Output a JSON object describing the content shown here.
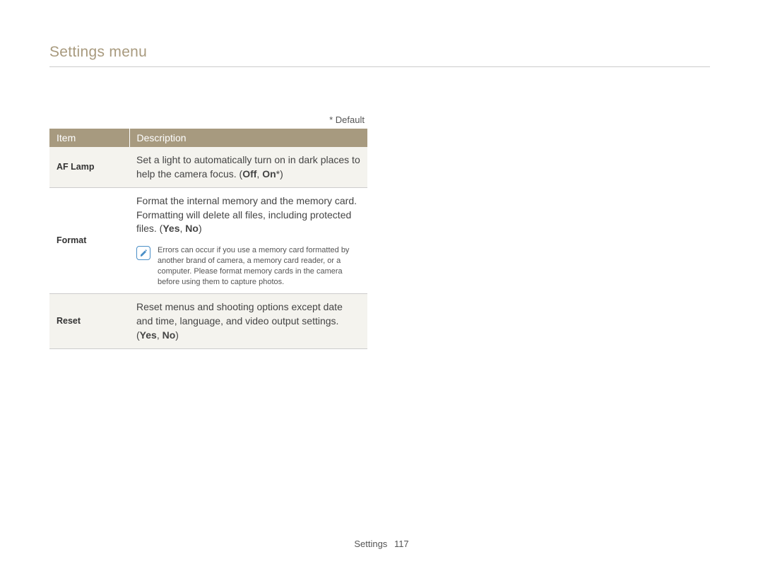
{
  "page_title": "Settings menu",
  "default_note": "* Default",
  "table": {
    "headers": {
      "item": "Item",
      "description": "Description"
    },
    "rows": [
      {
        "item": "AF Lamp",
        "desc_pre": "Set a light to automatically turn on in dark places to help the camera focus. (",
        "opt1": "Off",
        "sep": ", ",
        "opt2": "On",
        "opt2_suffix": "*",
        "desc_post": ")"
      },
      {
        "item": "Format",
        "desc_pre": "Format the internal memory and the memory card. Formatting will delete all files, including protected files. (",
        "opt1": "Yes",
        "sep": ", ",
        "opt2": "No",
        "desc_post": ")",
        "note": "Errors can occur if you use a memory card formatted by another brand of camera, a memory card reader, or a computer. Please format memory cards in the camera before using them to capture photos."
      },
      {
        "item": "Reset",
        "desc_pre": "Reset menus and shooting options except date and time, language, and video output settings. (",
        "opt1": "Yes",
        "sep": ", ",
        "opt2": "No",
        "desc_post": ")"
      }
    ]
  },
  "footer": {
    "section": "Settings",
    "page": "117"
  }
}
